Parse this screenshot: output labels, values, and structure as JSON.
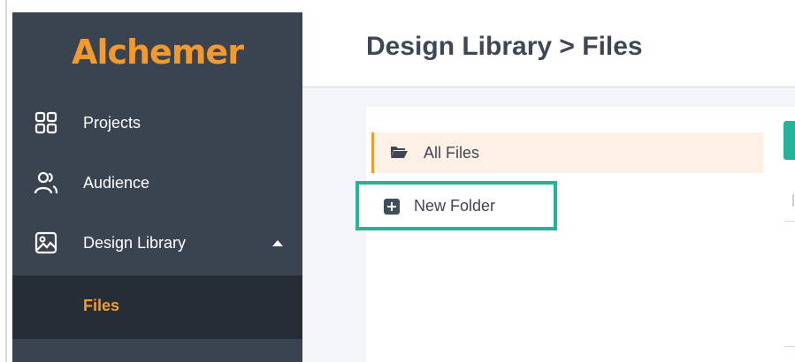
{
  "app": {
    "brand": "Alchemer"
  },
  "sidebar": {
    "items": [
      {
        "label": "Projects",
        "icon": "grid-icon"
      },
      {
        "label": "Audience",
        "icon": "users-icon"
      },
      {
        "label": "Design Library",
        "icon": "image-icon",
        "expanded": true
      }
    ],
    "subitems": [
      {
        "label": "Files",
        "active": true
      }
    ]
  },
  "header": {
    "title": "Design Library > Files"
  },
  "folders": {
    "items": [
      {
        "label": "All Files",
        "icon": "folder-open-icon",
        "selected": true
      }
    ],
    "new_folder_label": "New Folder"
  },
  "colors": {
    "sidebar_bg": "#3a4350",
    "accent_orange": "#f29a2e",
    "highlight_teal": "#26b39a"
  }
}
